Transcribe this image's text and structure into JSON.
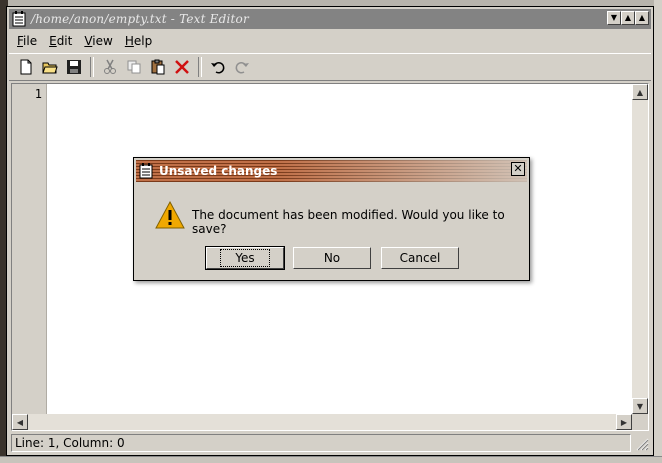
{
  "window": {
    "title": "/home/anon/empty.txt - Text Editor",
    "title_icon": "notepad-icon",
    "controls": [
      "menu-arrow-icon",
      "minimize-icon",
      "maximize-icon"
    ]
  },
  "menubar": {
    "items": [
      {
        "label": "File",
        "mnemonic": "F",
        "rest": "ile"
      },
      {
        "label": "Edit",
        "mnemonic": "E",
        "rest": "dit"
      },
      {
        "label": "View",
        "mnemonic": "V",
        "rest": "iew"
      },
      {
        "label": "Help",
        "mnemonic": "H",
        "rest": "elp"
      }
    ]
  },
  "toolbar": {
    "buttons": [
      "new-file-icon",
      "open-folder-icon",
      "save-disk-icon",
      "cut-icon",
      "copy-icon",
      "paste-icon",
      "delete-icon",
      "undo-icon",
      "redo-icon"
    ]
  },
  "editor": {
    "line_numbers": [
      "1"
    ],
    "content": ""
  },
  "statusbar": {
    "text": "Line: 1, Column: 0"
  },
  "dialog": {
    "title": "Unsaved changes",
    "message": "The document has been modified. Would you like to save?",
    "icon": "warning-icon",
    "buttons": {
      "yes": "Yes",
      "no": "No",
      "cancel": "Cancel"
    },
    "default_button": "yes"
  },
  "colors": {
    "chrome": "#d4d0c8",
    "titlebar_inactive": "#838383",
    "dialog_titlebar": "#a0522d",
    "warning": "#f0a800"
  }
}
